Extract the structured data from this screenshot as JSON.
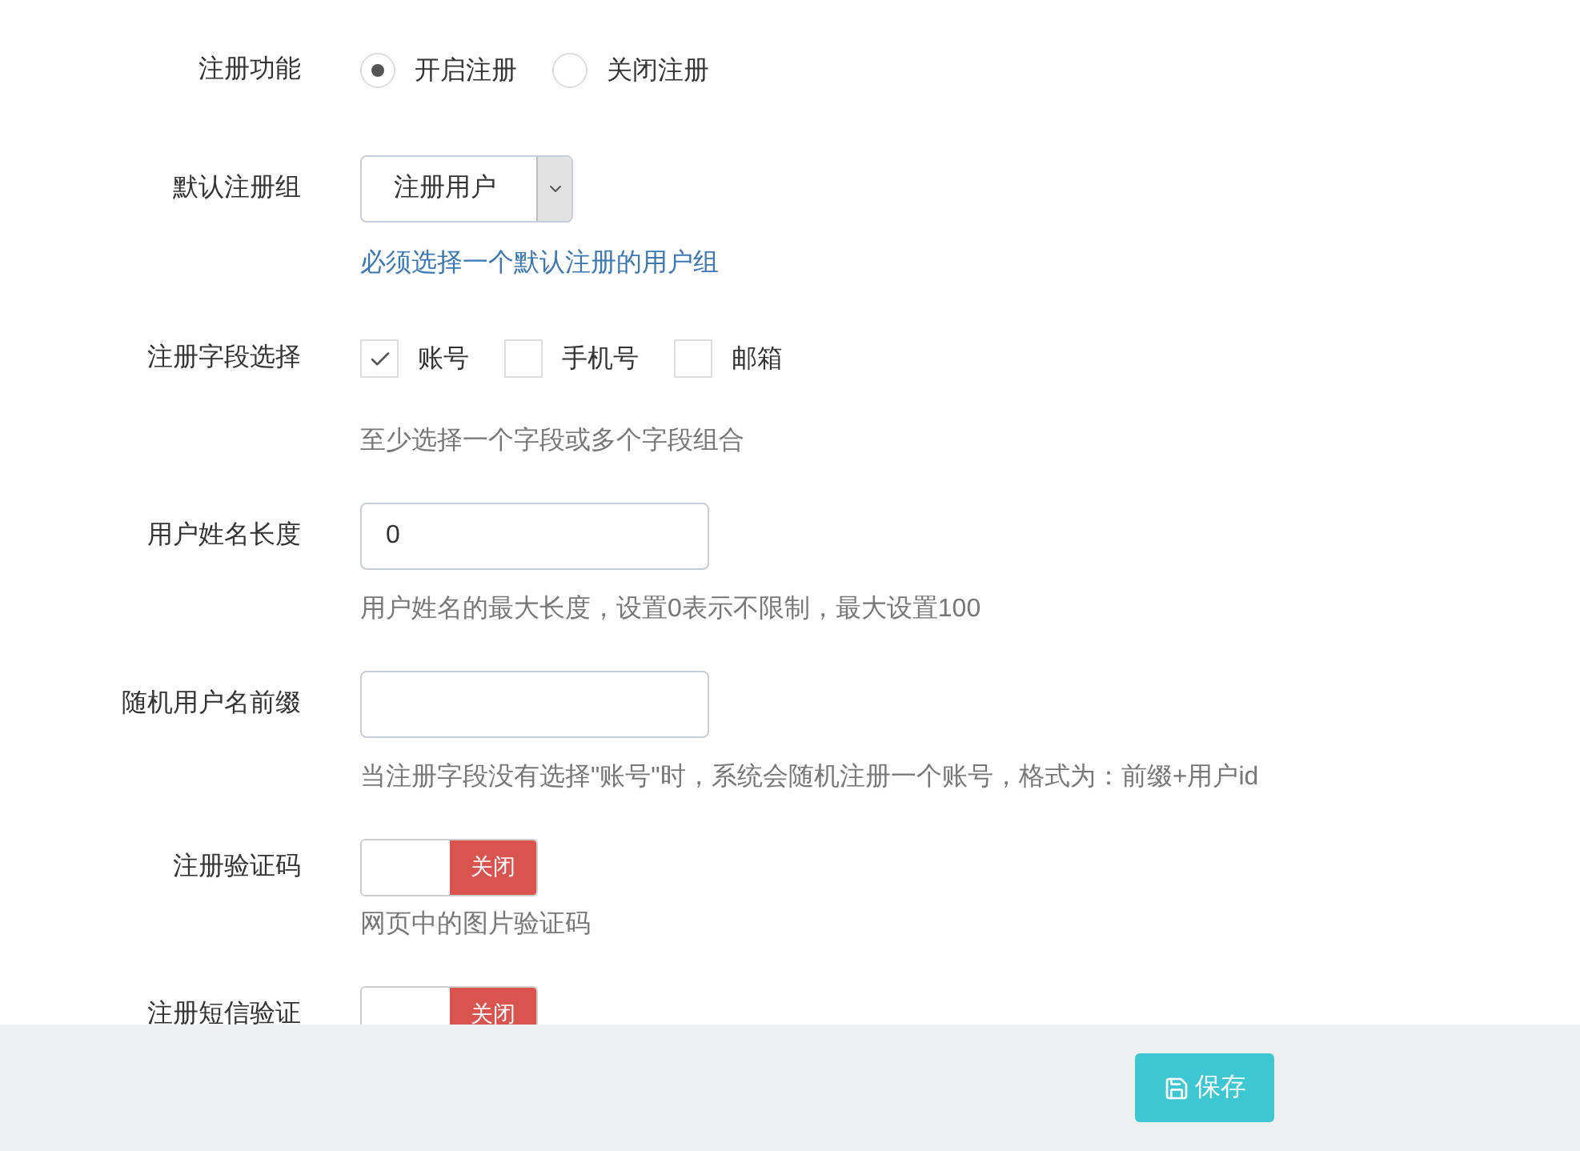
{
  "fields": [
    {
      "label": "注册功能",
      "kind": "radio",
      "options": [
        {
          "label": "开启注册",
          "selected": true
        },
        {
          "label": "关闭注册",
          "selected": false
        }
      ]
    },
    {
      "label": "默认注册组",
      "kind": "select",
      "value": "注册用户",
      "help": "必须选择一个默认注册的用户组",
      "help_link": true
    },
    {
      "label": "注册字段选择",
      "kind": "checkbox",
      "options": [
        {
          "label": "账号",
          "checked": true
        },
        {
          "label": "手机号",
          "checked": false
        },
        {
          "label": "邮箱",
          "checked": false
        }
      ],
      "help": "至少选择一个字段或多个字段组合",
      "help_link": false
    },
    {
      "label": "用户姓名长度",
      "kind": "text",
      "value": "0",
      "help": "用户姓名的最大长度，设置0表示不限制，最大设置100",
      "help_link": false
    },
    {
      "label": "随机用户名前缀",
      "kind": "text",
      "help": "当注册字段没有选择\"账号\"时，系统会随机注册一个账号，格式为：前缀+用户id",
      "help_link": false
    },
    {
      "label": "注册验证码",
      "kind": "switch",
      "on": false,
      "switch_text": "关闭",
      "help": "网页中的图片验证码",
      "help_link": false
    },
    {
      "label": "注册短信验证",
      "kind": "switch",
      "on": false,
      "switch_text": "关闭"
    }
  ],
  "footer": {
    "save_button": "保存"
  }
}
